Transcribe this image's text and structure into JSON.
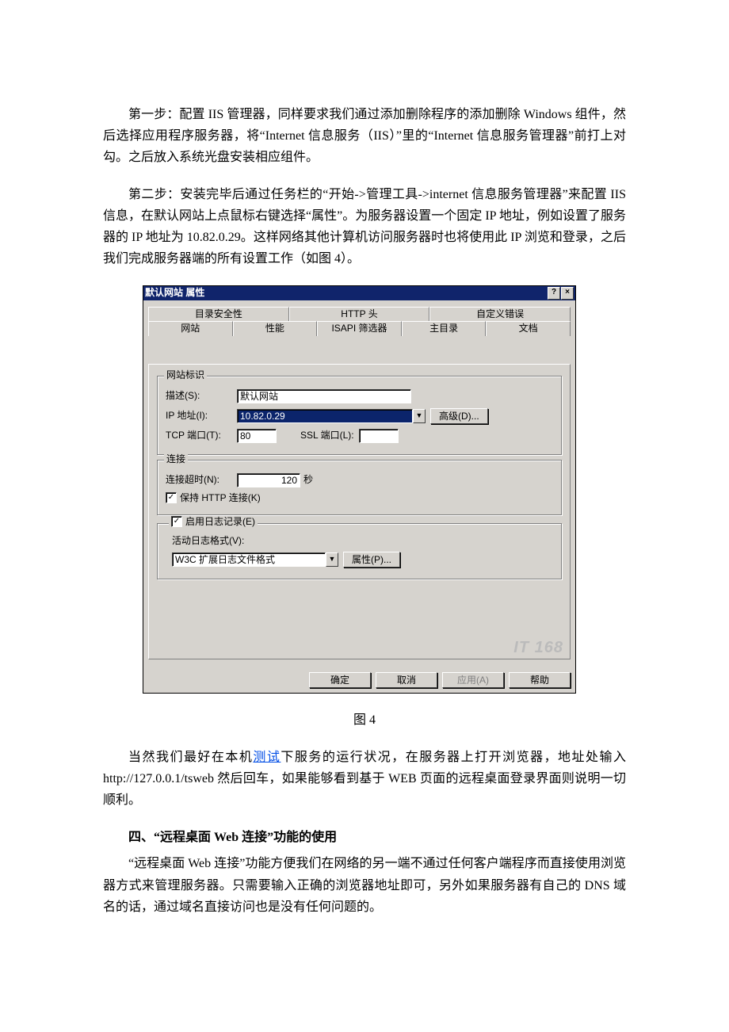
{
  "paragraphs": {
    "p1": "第一步：配置 IIS 管理器，同样要求我们通过添加删除程序的添加删除 Windows 组件，然后选择应用程序服务器，将“Internet 信息服务（IIS）”里的“Internet 信息服务管理器”前打上对勾。之后放入系统光盘安装相应组件。",
    "p2": "第二步：安装完毕后通过任务栏的“开始->管理工具->internet 信息服务管理器”来配置 IIS 信息，在默认网站上点鼠标右键选择“属性”。为服务器设置一个固定 IP 地址，例如设置了服务器的 IP 地址为 10.82.0.29。这样网络其他计算机访问服务器时也将使用此 IP 浏览和登录，之后我们完成服务器端的所有设置工作（如图 4）。",
    "fig": "图 4",
    "p3a": "当然我们最好在本机",
    "p3link": "测试",
    "p3b": "下服务的运行状况，在服务器上打开浏览器，地址处输入 http://127.0.0.1/tsweb 然后回车，如果能够看到基于 WEB 页面的远程桌面登录界面则说明一切顺利。",
    "h4": "四、“远程桌面 Web 连接”功能的使用",
    "p4": "“远程桌面 Web 连接”功能方便我们在网络的另一端不通过任何客户端程序而直接使用浏览器方式来管理服务器。只需要输入正确的浏览器地址即可，另外如果服务器有自己的 DNS 域名的话，通过域名直接访问也是没有任何问题的。"
  },
  "dialog": {
    "title": "默认网站 属性",
    "help_btn": "?",
    "close_btn": "×",
    "tabs_back": [
      "目录安全性",
      "HTTP 头",
      "自定义错误"
    ],
    "tabs_front": [
      "网站",
      "性能",
      "ISAPI 筛选器",
      "主目录",
      "文档"
    ],
    "group_id": {
      "title": "网站标识",
      "desc_label": "描述(S):",
      "desc_value": "默认网站",
      "ip_label": "IP 地址(I):",
      "ip_value": "10.82.0.29",
      "advanced_btn": "高级(D)...",
      "tcp_label": "TCP 端口(T):",
      "tcp_value": "80",
      "ssl_label": "SSL 端口(L):",
      "ssl_value": ""
    },
    "group_conn": {
      "title": "连接",
      "timeout_label": "连接超时(N):",
      "timeout_value": "120",
      "timeout_unit": "秒",
      "keep_label": "保持 HTTP 连接(K)",
      "keep_checked": "✓"
    },
    "group_log": {
      "enable_label": "启用日志记录(E)",
      "enable_checked": "✓",
      "format_label": "活动日志格式(V):",
      "format_value": "W3C 扩展日志文件格式",
      "props_btn": "属性(P)..."
    },
    "buttons": {
      "ok": "确定",
      "cancel": "取消",
      "apply": "应用(A)",
      "help": "帮助"
    },
    "watermark": "IT 168"
  }
}
